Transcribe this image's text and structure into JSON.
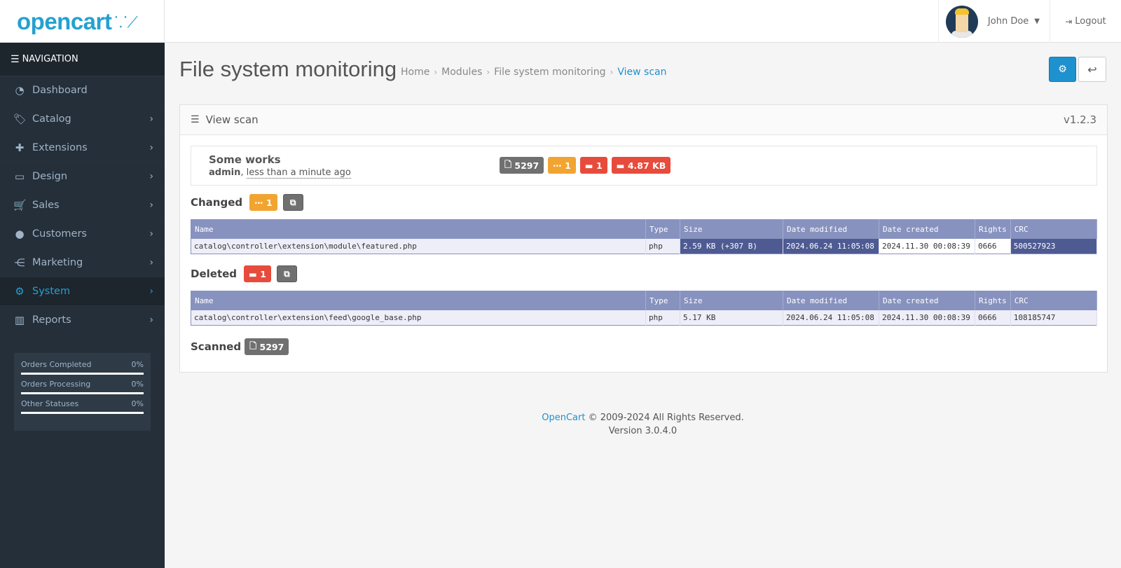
{
  "header": {
    "logo_text": "opencart",
    "user_name": "John Doe",
    "logout_label": "Logout"
  },
  "sidebar": {
    "nav_title": "NAVIGATION",
    "items": [
      {
        "label": "Dashboard",
        "icon": "dashboard-icon"
      },
      {
        "label": "Catalog",
        "icon": "tags-icon"
      },
      {
        "label": "Extensions",
        "icon": "puzzle-icon"
      },
      {
        "label": "Design",
        "icon": "monitor-icon"
      },
      {
        "label": "Sales",
        "icon": "cart-icon"
      },
      {
        "label": "Customers",
        "icon": "user-icon"
      },
      {
        "label": "Marketing",
        "icon": "share-icon"
      },
      {
        "label": "System",
        "icon": "gear-icon",
        "active": true
      },
      {
        "label": "Reports",
        "icon": "bar-chart-icon"
      }
    ],
    "stats": [
      {
        "label": "Orders Completed",
        "value": "0%"
      },
      {
        "label": "Orders Processing",
        "value": "0%"
      },
      {
        "label": "Other Statuses",
        "value": "0%"
      }
    ]
  },
  "page": {
    "title": "File system monitoring",
    "breadcrumb": [
      "Home",
      "Modules",
      "File system monitoring",
      "View scan"
    ]
  },
  "panel": {
    "title": "View scan",
    "version": "v1.2.3",
    "scan": {
      "name": "Some works",
      "user": "admin",
      "time": "less than a minute ago",
      "badges": {
        "scanned": "5297",
        "changed": "1",
        "deleted": "1",
        "size": "4.87 KB"
      }
    },
    "changed": {
      "label": "Changed",
      "count": "1",
      "columns": [
        "Name",
        "Type",
        "Size",
        "Date modified",
        "Date created",
        "Rights",
        "CRC"
      ],
      "rows": [
        [
          "catalog\\controller\\extension\\module\\featured.php",
          "php",
          "2.59 KB (+307 B)",
          "2024.06.24 11:05:08",
          "2024.11.30 00:08:39",
          "0666",
          "500527923"
        ]
      ]
    },
    "deleted": {
      "label": "Deleted",
      "count": "1",
      "columns": [
        "Name",
        "Type",
        "Size",
        "Date modified",
        "Date created",
        "Rights",
        "CRC"
      ],
      "rows": [
        [
          "catalog\\controller\\extension\\feed\\google_base.php",
          "php",
          "5.17 KB",
          "2024.06.24 11:05:08",
          "2024.11.30 00:08:39",
          "0666",
          "108185747"
        ]
      ]
    },
    "scanned": {
      "label": "Scanned",
      "count": "5297"
    }
  },
  "footer": {
    "brand": "OpenCart",
    "copyright": "© 2009-2024 All Rights Reserved.",
    "version": "Version 3.0.4.0"
  },
  "colors": {
    "accent": "#1e91cf",
    "sidebar_bg": "#252f39",
    "badge_grey": "#707070",
    "badge_orange": "#f2a431",
    "badge_red": "#e74b3c",
    "table_header": "#8892bf",
    "highlight": "#4e5b93"
  }
}
